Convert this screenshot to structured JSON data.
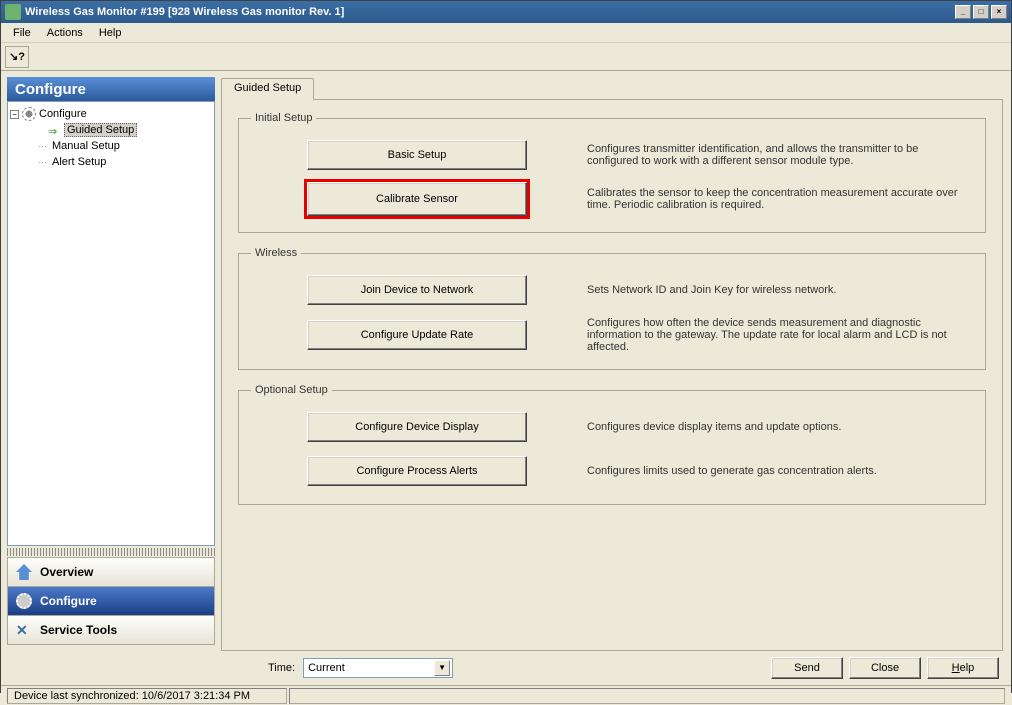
{
  "window": {
    "title": "Wireless Gas Monitor #199 [928 Wireless Gas monitor Rev. 1]",
    "min_label": "_",
    "max_label": "□",
    "close_label": "×"
  },
  "menu": {
    "file": "File",
    "actions": "Actions",
    "help": "Help"
  },
  "toolbar": {
    "help_icon": "?"
  },
  "side_header": "Configure",
  "tree": {
    "root": "Configure",
    "children": [
      {
        "label": "Guided Setup",
        "selected": true
      },
      {
        "label": "Manual Setup",
        "selected": false
      },
      {
        "label": "Alert Setup",
        "selected": false
      }
    ]
  },
  "nav": {
    "overview": "Overview",
    "configure": "Configure",
    "service_tools": "Service Tools"
  },
  "tab": {
    "guided_setup": "Guided Setup"
  },
  "groups": {
    "initial": {
      "legend": "Initial Setup"
    },
    "wireless": {
      "legend": "Wireless"
    },
    "optional": {
      "legend": "Optional Setup"
    }
  },
  "buttons": {
    "basic_setup": "Basic Setup",
    "calibrate_sensor": "Calibrate Sensor",
    "join_device": "Join Device to Network",
    "configure_update_rate": "Configure Update Rate",
    "configure_device_display": "Configure Device Display",
    "configure_process_alerts": "Configure Process Alerts"
  },
  "descriptions": {
    "basic_setup": "Configures transmitter identification, and allows the transmitter to be configured to work with a different sensor module type.",
    "calibrate_sensor": "Calibrates the sensor to keep the concentration measurement accurate over time. Periodic calibration is required.",
    "join_device": "Sets Network ID and Join Key for wireless network.",
    "configure_update_rate": "Configures how often the device sends measurement and diagnostic information to the gateway. The update rate for local alarm and LCD is not affected.",
    "configure_device_display": "Configures device display items and update options.",
    "configure_process_alerts": "Configures limits used to generate gas concentration alerts."
  },
  "bottom": {
    "time_label": "Time:",
    "time_value": "Current",
    "send": "Send",
    "close": "Close",
    "help": "Help"
  },
  "status": "Device last synchronized: 10/6/2017 3:21:34 PM",
  "highlighted_button": "calibrate_sensor"
}
